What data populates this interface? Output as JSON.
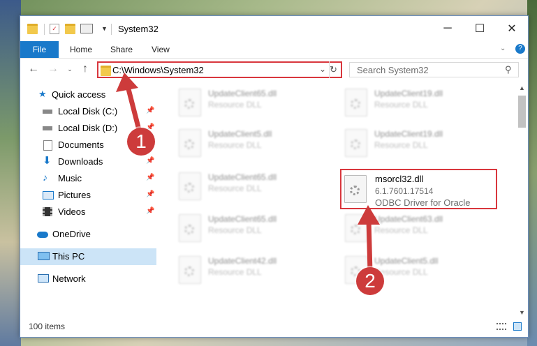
{
  "window": {
    "title": "System32",
    "minimize": "─",
    "maximize": "☐",
    "close": "✕"
  },
  "ribbon": {
    "tabs": [
      "File",
      "Home",
      "Share",
      "View"
    ]
  },
  "address": {
    "path": "C:\\Windows\\System32",
    "search_placeholder": "Search System32"
  },
  "sidebar": {
    "items": [
      {
        "label": "Quick access",
        "icon": "star-icon",
        "pinned": false
      },
      {
        "label": "Local Disk (C:)",
        "icon": "drive-icon",
        "pinned": true
      },
      {
        "label": "Local Disk (D:)",
        "icon": "drive-icon",
        "pinned": true
      },
      {
        "label": "Documents",
        "icon": "documents-icon",
        "pinned": true
      },
      {
        "label": "Downloads",
        "icon": "download-icon",
        "pinned": true
      },
      {
        "label": "Music",
        "icon": "music-icon",
        "pinned": true
      },
      {
        "label": "Pictures",
        "icon": "pictures-icon",
        "pinned": true
      },
      {
        "label": "Videos",
        "icon": "videos-icon",
        "pinned": true
      },
      {
        "label": "OneDrive",
        "icon": "cloud-icon",
        "pinned": false
      },
      {
        "label": "This PC",
        "icon": "computer-icon",
        "pinned": false
      },
      {
        "label": "Network",
        "icon": "network-icon",
        "pinned": false
      }
    ]
  },
  "files": [
    {
      "name": "UpdateClient65.dll",
      "desc": "Resource DLL"
    },
    {
      "name": "UpdateClient19.dll",
      "desc": "Resource DLL"
    },
    {
      "name": "UpdateClient5.dll",
      "desc": "Resource DLL"
    },
    {
      "name": "UpdateClient19.dll",
      "desc": "Resource DLL"
    },
    {
      "name": "UpdateClient65.dll",
      "desc": "Resource DLL"
    },
    {
      "name": "UpdateClient63.dll",
      "desc": "Resource DLL"
    },
    {
      "name": "UpdateClient65.dll",
      "desc": "Resource DLL"
    },
    {
      "name": "UpdateClient42.dll",
      "desc": "Resource DLL"
    },
    {
      "name": "UpdateClient5.dll",
      "desc": "Resource DLL"
    }
  ],
  "highlighted_file": {
    "name": "msorcl32.dll",
    "version": "6.1.7601.17514",
    "description": "ODBC Driver for Oracle"
  },
  "status": {
    "item_count": "100 items"
  },
  "annotations": {
    "step1": "1",
    "step2": "2"
  },
  "colors": {
    "accent": "#1979ca",
    "highlight_border": "#d9373d",
    "selection": "#cce4f7"
  }
}
